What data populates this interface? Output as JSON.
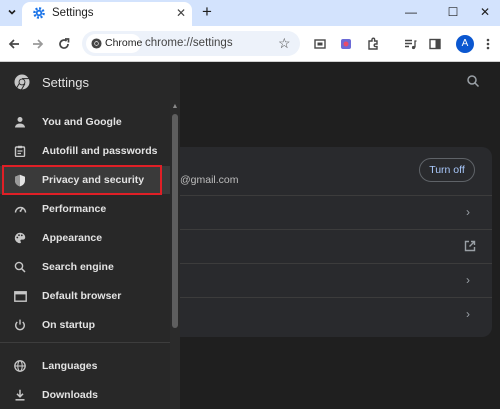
{
  "browser": {
    "tab": {
      "title": "Settings",
      "icon": "gear-icon",
      "close": "✕"
    },
    "new_tab": "+",
    "window_controls": {
      "minimize": "—",
      "maximize": "☐",
      "close": "✕"
    },
    "toolbar": {
      "chip_label": "Chrome",
      "url": "chrome://settings",
      "avatar_letter": "A"
    }
  },
  "settings": {
    "title": "Settings",
    "sidebar": {
      "items": [
        {
          "label": "You and Google",
          "icon": "person-icon"
        },
        {
          "label": "Autofill and passwords",
          "icon": "clipboard-icon"
        },
        {
          "label": "Privacy and security",
          "icon": "shield-icon",
          "selected": true
        },
        {
          "label": "Performance",
          "icon": "gauge-icon"
        },
        {
          "label": "Appearance",
          "icon": "palette-icon"
        },
        {
          "label": "Search engine",
          "icon": "search-icon"
        },
        {
          "label": "Default browser",
          "icon": "browser-icon"
        },
        {
          "label": "On startup",
          "icon": "power-icon"
        },
        {
          "label": "Languages",
          "icon": "globe-icon"
        },
        {
          "label": "Downloads",
          "icon": "download-icon"
        }
      ]
    },
    "main": {
      "email_fragment": "@gmail.com",
      "turn_off_label": "Turn off"
    }
  },
  "colors": {
    "highlight": "#e01f26",
    "accent": "#a8c7fa",
    "tabstrip": "#d3e3fd"
  }
}
